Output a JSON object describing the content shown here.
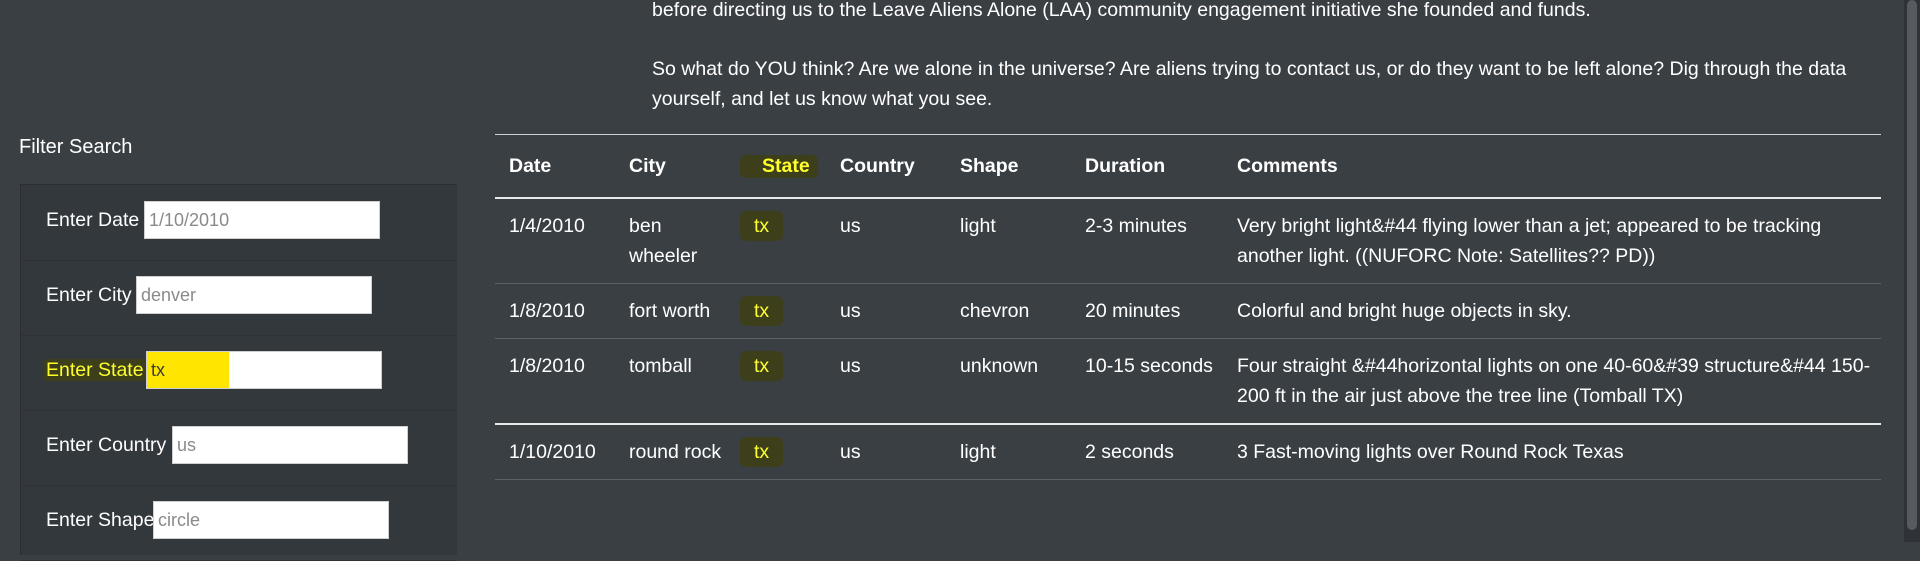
{
  "intro": {
    "p1": "before directing us to the Leave Aliens Alone (LAA) community engagement initiative she founded and funds.",
    "p2": "So what do YOU think? Are we alone in the universe? Are aliens trying to contact us, or do they want to be left alone? Dig through the data yourself, and let us know what you see."
  },
  "filter": {
    "title": "Filter Search",
    "fields": [
      {
        "label": "Enter Date",
        "placeholder": "1/10/2010",
        "value": ""
      },
      {
        "label": "Enter City",
        "placeholder": "denver",
        "value": ""
      },
      {
        "label": "Enter State",
        "placeholder": "",
        "value": "tx"
      },
      {
        "label": "Enter Country",
        "placeholder": "us",
        "value": ""
      },
      {
        "label": "Enter Shape",
        "placeholder": "circle",
        "value": ""
      }
    ]
  },
  "table": {
    "headers": [
      "Date",
      "City",
      "State",
      "Country",
      "Shape",
      "Duration",
      "Comments"
    ],
    "rows": [
      [
        "1/4/2010",
        "ben wheeler",
        "tx",
        "us",
        "light",
        "2-3 minutes",
        "Very bright light&#44 flying lower than a jet; appeared to be tracking another light. ((NUFORC Note: Satellites?? PD))"
      ],
      [
        "1/8/2010",
        "fort worth",
        "tx",
        "us",
        "chevron",
        "20 minutes",
        "Colorful and bright huge objects in sky."
      ],
      [
        "1/8/2010",
        "tomball",
        "tx",
        "us",
        "unknown",
        "10-15 seconds",
        "Four straight &#44horizontal lights on one 40-60&#39 structure&#44 150-200 ft in the air just above the tree line (Tomball TX)"
      ],
      [
        "1/10/2010",
        "round rock",
        "tx",
        "us",
        "light",
        "2 seconds",
        "3 Fast-moving lights over Round Rock Texas"
      ]
    ]
  },
  "colors": {
    "background": "#3a3f44",
    "highlight": "#ffff2e",
    "input_highlight": "#ffe600"
  }
}
